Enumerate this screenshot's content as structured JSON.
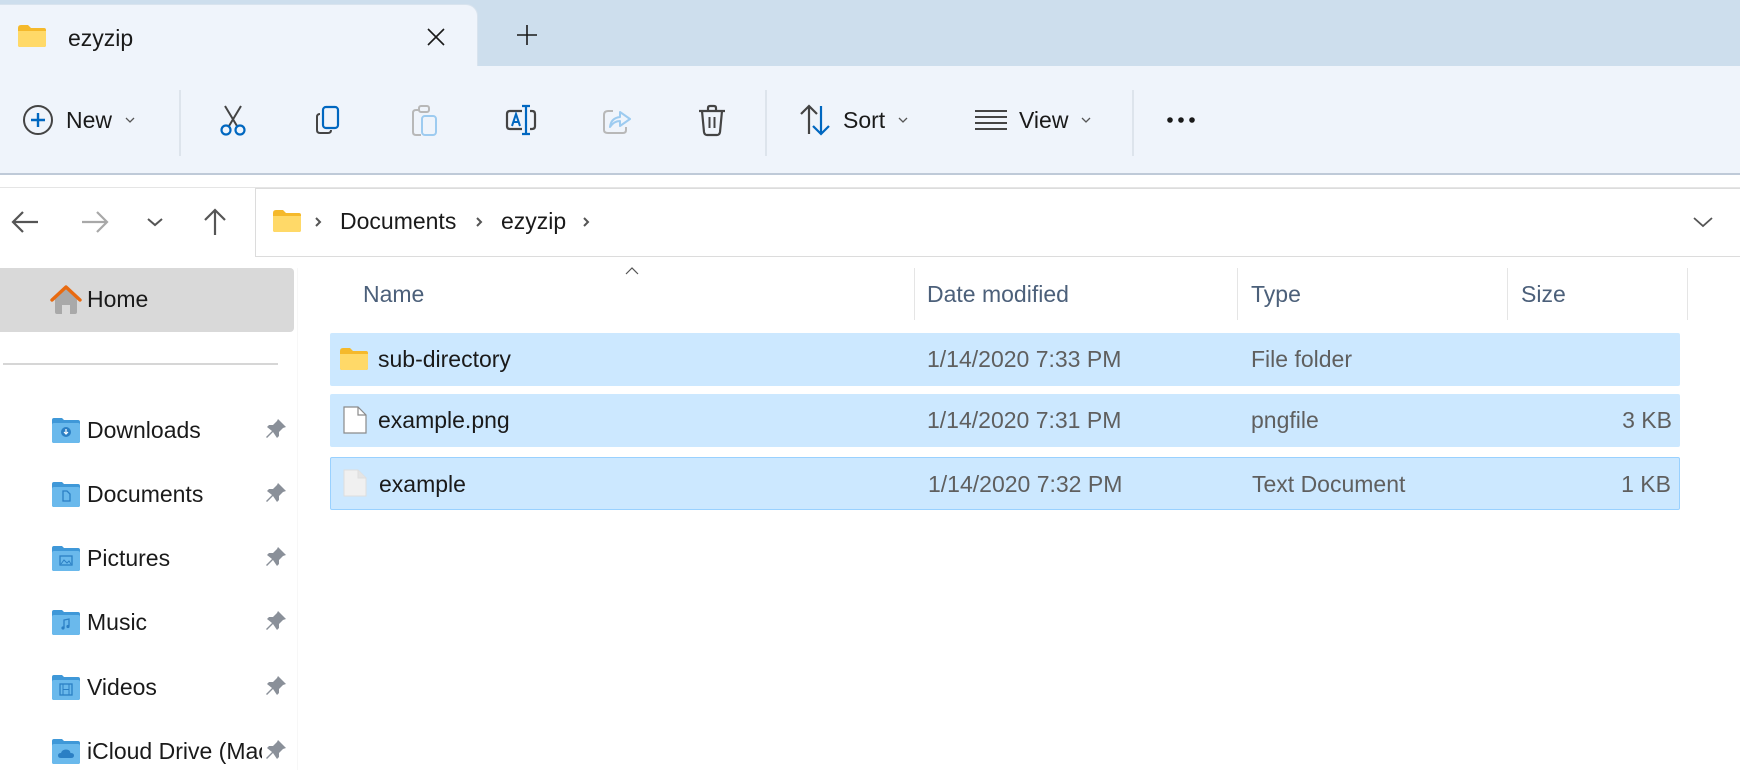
{
  "tab": {
    "title": "ezyzip",
    "close_icon": "close-icon",
    "new_tab_icon": "plus-icon"
  },
  "toolbar": {
    "new_label": "New",
    "sort_label": "Sort",
    "view_label": "View",
    "buttons": [
      {
        "name": "cut",
        "icon": "scissors-icon",
        "enabled": true
      },
      {
        "name": "copy",
        "icon": "copy-icon",
        "enabled": true
      },
      {
        "name": "paste",
        "icon": "clipboard-icon",
        "enabled": false
      },
      {
        "name": "rename",
        "icon": "rename-icon",
        "enabled": true
      },
      {
        "name": "share",
        "icon": "share-icon",
        "enabled": false
      },
      {
        "name": "delete",
        "icon": "trash-icon",
        "enabled": true
      }
    ],
    "more_icon": "ellipsis-icon"
  },
  "nav": {
    "back_enabled": true,
    "forward_enabled": false
  },
  "address": {
    "crumbs": [
      "Documents",
      "ezyzip"
    ]
  },
  "sidebar": {
    "home_label": "Home",
    "items": [
      {
        "label": "Downloads",
        "icon": "downloads-folder-icon",
        "pinned": true
      },
      {
        "label": "Documents",
        "icon": "documents-folder-icon",
        "pinned": true
      },
      {
        "label": "Pictures",
        "icon": "pictures-folder-icon",
        "pinned": true
      },
      {
        "label": "Music",
        "icon": "music-folder-icon",
        "pinned": true
      },
      {
        "label": "Videos",
        "icon": "videos-folder-icon",
        "pinned": true
      },
      {
        "label": "iCloud Drive (Mac)",
        "icon": "icloud-folder-icon",
        "pinned": true
      }
    ]
  },
  "files": {
    "columns": [
      "Name",
      "Date modified",
      "Type",
      "Size"
    ],
    "sort_column": "Name",
    "sort_direction": "ascending",
    "rows": [
      {
        "name": "sub-directory",
        "date": "1/14/2020 7:33 PM",
        "type": "File folder",
        "size": "",
        "kind": "folder",
        "selected": true
      },
      {
        "name": "example.png",
        "date": "1/14/2020 7:31 PM",
        "type": "pngfile",
        "size": "3 KB",
        "kind": "file",
        "selected": true
      },
      {
        "name": "example",
        "date": "1/14/2020 7:32 PM",
        "type": "Text Document",
        "size": "1 KB",
        "kind": "text",
        "selected": true,
        "focused": true
      }
    ]
  },
  "colors": {
    "accent": "#0067c0",
    "selection": "#cce8ff",
    "selection_border": "#99d1ff",
    "folder_yellow": "#ffc83d",
    "library_blue": "#5cb0e6"
  }
}
